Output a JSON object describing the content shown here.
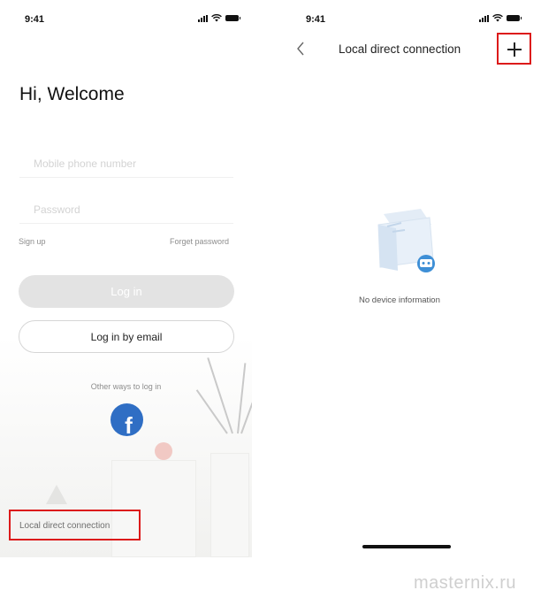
{
  "left_screen": {
    "status": {
      "time": "9:41",
      "icons": [
        "signal-icon",
        "wifi-icon",
        "battery-icon"
      ]
    },
    "heading": "Hi, Welcome",
    "phone_field": {
      "placeholder": "Mobile phone number"
    },
    "password_field": {
      "placeholder": "Password"
    },
    "sign_up": "Sign up",
    "forgot_password": "Forget password",
    "login_button": "Log in",
    "email_button": "Log in by email",
    "other_ways": "Other ways to log in",
    "facebook_icon": "facebook-icon",
    "local_direct_link": "Local direct connection"
  },
  "right_screen": {
    "status": {
      "time": "9:41",
      "icons": [
        "signal-icon",
        "wifi-icon",
        "battery-icon"
      ]
    },
    "back_icon": "chevron-left-icon",
    "title": "Local direct connection",
    "add_icon": "plus-icon",
    "empty_message": "No device information"
  },
  "highlight_color": "#dc1a1a",
  "watermark": "masternix.ru"
}
